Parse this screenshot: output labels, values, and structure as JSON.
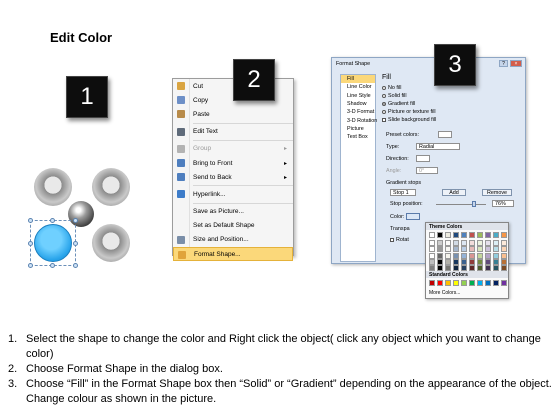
{
  "title": "Edit Color",
  "badges": [
    "1",
    "2",
    "3"
  ],
  "context_menu": {
    "items": [
      {
        "label": "Cut",
        "disabled": false,
        "submenu": false,
        "highlight": false,
        "icon": "scissors-icon",
        "color": "#d9a441"
      },
      {
        "label": "Copy",
        "disabled": false,
        "submenu": false,
        "highlight": false,
        "icon": "copy-icon",
        "color": "#6d8fc7"
      },
      {
        "label": "Paste",
        "disabled": false,
        "submenu": false,
        "highlight": false,
        "icon": "paste-icon",
        "color": "#b88b4a"
      },
      {
        "sep": true
      },
      {
        "label": "Edit Text",
        "disabled": false,
        "submenu": false,
        "highlight": false,
        "icon": "edit-text-icon",
        "color": "#5f6b7a"
      },
      {
        "sep": true
      },
      {
        "label": "Group",
        "disabled": true,
        "submenu": true,
        "highlight": false,
        "icon": "group-icon",
        "color": "#b3b3b3"
      },
      {
        "label": "Bring to Front",
        "disabled": false,
        "submenu": true,
        "highlight": false,
        "icon": "bring-to-front-icon",
        "color": "#4f7fbf"
      },
      {
        "label": "Send to Back",
        "disabled": false,
        "submenu": true,
        "highlight": false,
        "icon": "send-to-back-icon",
        "color": "#4f7fbf"
      },
      {
        "sep": true
      },
      {
        "label": "Hyperlink...",
        "disabled": false,
        "submenu": false,
        "highlight": false,
        "icon": "hyperlink-icon",
        "color": "#3d7cc9"
      },
      {
        "sep": true
      },
      {
        "label": "Save as Picture...",
        "disabled": false,
        "submenu": false,
        "highlight": false,
        "icon": "",
        "color": ""
      },
      {
        "label": "Set as Default Shape",
        "disabled": false,
        "submenu": false,
        "highlight": false,
        "icon": "",
        "color": ""
      },
      {
        "label": "Size and Position...",
        "disabled": false,
        "submenu": false,
        "highlight": false,
        "icon": "size-position-icon",
        "color": "#7a8ea8"
      },
      {
        "label": "Format Shape...",
        "disabled": false,
        "submenu": false,
        "highlight": true,
        "icon": "format-shape-icon",
        "color": "#e0a43a"
      }
    ]
  },
  "dialog": {
    "title": "Format Shape",
    "sidebar": [
      "Fill",
      "Line Color",
      "Line Style",
      "Shadow",
      "3-D Format",
      "3-D Rotation",
      "Picture",
      "Text Box"
    ],
    "fill_heading": "Fill",
    "fill_options": [
      {
        "label": "No fill",
        "type": "radio",
        "checked": false
      },
      {
        "label": "Solid fill",
        "type": "radio",
        "checked": false
      },
      {
        "label": "Gradient fill",
        "type": "radio",
        "checked": true
      },
      {
        "label": "Picture or texture fill",
        "type": "radio",
        "checked": false
      },
      {
        "label": "Slide background fill",
        "type": "checkbox",
        "checked": false
      }
    ],
    "preset_colors_label": "Preset colors:",
    "type_label": "Type:",
    "type_value": "Radial",
    "direction_label": "Direction:",
    "angle_label": "Angle:",
    "angle_value": "0°",
    "gradient_stops_label": "Gradient stops",
    "stop_value": "Stop 1",
    "add_label": "Add",
    "remove_label": "Remove",
    "stop_position_label": "Stop position:",
    "stop_position_value": "76%",
    "color_label": "Color:",
    "transparency_label": "Transpa",
    "rotate_label": "Rotat",
    "theme_colors_label": "Theme Colors",
    "standard_colors_label": "Standard Colors",
    "more_colors_label": "More Colors...",
    "theme_base": [
      "#ffffff",
      "#000000",
      "#eeece1",
      "#1f497d",
      "#4f81bd",
      "#c0504d",
      "#9bbb59",
      "#8064a2",
      "#4bacc6",
      "#f79646"
    ],
    "standard": [
      "#c00000",
      "#ff0000",
      "#ffc000",
      "#ffff00",
      "#92d050",
      "#00b050",
      "#00b0f0",
      "#0070c0",
      "#002060",
      "#7030a0"
    ]
  },
  "steps": [
    {
      "num": "1.",
      "text": "Select the shape to change the color and Right click the object( click any object which you want to change color)"
    },
    {
      "num": "2.",
      "text": "Choose Format Shape in the dialog box."
    },
    {
      "num": "3.",
      "text": "Choose “Fill” in the Format Shape box then “Solid” or “Gradient” depending on the appearance of the object. Change colour as shown in the picture."
    }
  ]
}
